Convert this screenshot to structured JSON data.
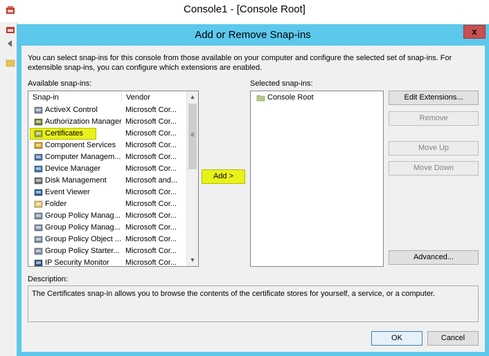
{
  "console": {
    "title": "Console1 - [Console Root]"
  },
  "dialog": {
    "title": "Add or Remove Snap-ins",
    "close_label": "x",
    "intro": "You can select snap-ins for this console from those available on your computer and configure the selected set of snap-ins. For extensible snap-ins, you can configure which extensions are enabled.",
    "available_label": "Available snap-ins:",
    "selected_label": "Selected snap-ins:",
    "columns": [
      "Snap-in",
      "Vendor"
    ],
    "available_items": [
      {
        "name": "ActiveX Control",
        "vendor": "Microsoft Cor...",
        "icon": "activex-icon",
        "color": "#7a8aa0"
      },
      {
        "name": "Authorization Manager",
        "vendor": "Microsoft Cor...",
        "icon": "authorization-manager-icon",
        "color": "#6b7c2f"
      },
      {
        "name": "Certificates",
        "vendor": "Microsoft Cor...",
        "icon": "certificates-icon",
        "color": "#9aa82a"
      },
      {
        "name": "Component Services",
        "vendor": "Microsoft Cor...",
        "icon": "component-services-icon",
        "color": "#d4a017"
      },
      {
        "name": "Computer Managem...",
        "vendor": "Microsoft Cor...",
        "icon": "computer-management-icon",
        "color": "#4a6fa5"
      },
      {
        "name": "Device Manager",
        "vendor": "Microsoft Cor...",
        "icon": "device-manager-icon",
        "color": "#3d6ea8"
      },
      {
        "name": "Disk Management",
        "vendor": "Microsoft and...",
        "icon": "disk-management-icon",
        "color": "#6a6a6a"
      },
      {
        "name": "Event Viewer",
        "vendor": "Microsoft Cor...",
        "icon": "event-viewer-icon",
        "color": "#2d5f9a"
      },
      {
        "name": "Folder",
        "vendor": "Microsoft Cor...",
        "icon": "folder-icon",
        "color": "#e8c35a"
      },
      {
        "name": "Group Policy Manag...",
        "vendor": "Microsoft Cor...",
        "icon": "group-policy-icon",
        "color": "#7a8aa0"
      },
      {
        "name": "Group Policy Manag...",
        "vendor": "Microsoft Cor...",
        "icon": "group-policy-icon",
        "color": "#7a8aa0"
      },
      {
        "name": "Group Policy Object ...",
        "vendor": "Microsoft Cor...",
        "icon": "group-policy-icon",
        "color": "#7a8aa0"
      },
      {
        "name": "Group Policy Starter...",
        "vendor": "Microsoft Cor...",
        "icon": "group-policy-icon",
        "color": "#7a8aa0"
      },
      {
        "name": "IP Security Monitor",
        "vendor": "Microsoft Cor...",
        "icon": "ip-security-icon",
        "color": "#2f4f7a"
      }
    ],
    "selected_item_index": 2,
    "selected_items": [
      {
        "name": "Console Root",
        "icon": "folder-icon"
      }
    ],
    "buttons": {
      "add": "Add >",
      "edit_extensions": "Edit Extensions...",
      "remove": "Remove",
      "move_up": "Move Up",
      "move_down": "Move Down",
      "advanced": "Advanced...",
      "ok": "OK",
      "cancel": "Cancel"
    },
    "description_label": "Description:",
    "description": "The Certificates snap-in allows you to browse the contents of the certificate stores for yourself, a service, or a computer."
  },
  "colors": {
    "dialog_frame": "#5cc8ec",
    "highlight": "#e8f11a",
    "close_button": "#c75050"
  }
}
